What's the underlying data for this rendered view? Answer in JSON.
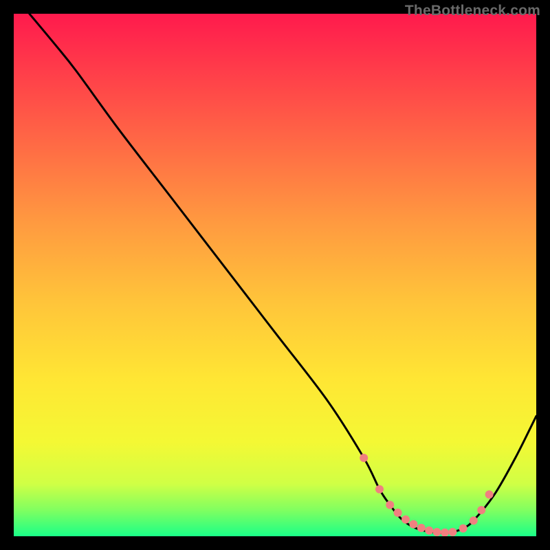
{
  "watermark": "TheBottleneck.com",
  "chart_data": {
    "type": "line",
    "title": "",
    "xlabel": "",
    "ylabel": "",
    "xlim": [
      0,
      100
    ],
    "ylim": [
      0,
      100
    ],
    "grid": false,
    "legend": false,
    "series": [
      {
        "name": "curve",
        "x": [
          3,
          8,
          12,
          20,
          30,
          40,
          50,
          60,
          67,
          70,
          72,
          74,
          76,
          78,
          80,
          82,
          84,
          86,
          88,
          92,
          96,
          100
        ],
        "y": [
          100,
          94,
          89,
          78,
          65,
          52,
          39,
          26,
          15,
          9,
          6,
          3.5,
          2,
          1.2,
          0.8,
          0.6,
          0.8,
          1.5,
          3,
          8,
          15,
          23
        ]
      }
    ],
    "markers": {
      "name": "highlight-points",
      "color": "#f08080",
      "x": [
        67,
        70,
        72,
        73.5,
        75,
        76.5,
        78,
        79.5,
        81,
        82.5,
        84,
        86,
        88,
        89.5,
        91
      ],
      "y": [
        15,
        9,
        6,
        4.5,
        3.2,
        2.3,
        1.6,
        1.1,
        0.8,
        0.7,
        0.8,
        1.5,
        3,
        5,
        8
      ]
    },
    "gradient_stops": [
      {
        "offset": 0.0,
        "color": "#ff1a4d"
      },
      {
        "offset": 0.1,
        "color": "#ff3a4a"
      },
      {
        "offset": 0.25,
        "color": "#ff6a45"
      },
      {
        "offset": 0.4,
        "color": "#ff9a40"
      },
      {
        "offset": 0.55,
        "color": "#ffc43a"
      },
      {
        "offset": 0.7,
        "color": "#ffe634"
      },
      {
        "offset": 0.82,
        "color": "#f4f834"
      },
      {
        "offset": 0.9,
        "color": "#d0ff45"
      },
      {
        "offset": 0.95,
        "color": "#80ff60"
      },
      {
        "offset": 1.0,
        "color": "#1aff88"
      }
    ]
  }
}
